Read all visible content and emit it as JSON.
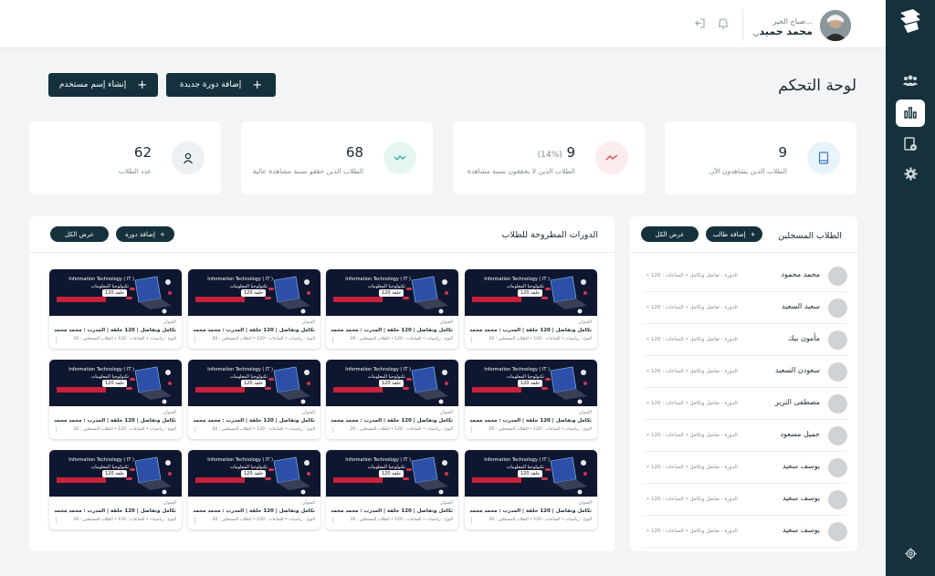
{
  "topbar": {
    "greeting": "صباح الخير...",
    "user_name": "محمد حميد"
  },
  "page": {
    "title": "لوحة التحكم",
    "add_course_label": "إضافة دورة جديدة",
    "create_user_label": "إنشاء إسم مستخدم"
  },
  "stats": [
    {
      "value": "9",
      "pct": "",
      "label": "الطلاب الذين يشاهدون الآن",
      "icon": "book-icon"
    },
    {
      "value": "9",
      "pct": "(14%)",
      "label": "الطلاب الذين لا يحققون نسبة مشاهدة",
      "icon": "trend-down-icon"
    },
    {
      "value": "68",
      "pct": "",
      "label": "الطلاب الذين حققو نسبة مشاهدة عالية",
      "icon": "trend-up-icon"
    },
    {
      "value": "62",
      "pct": "",
      "label": "عدد الطلاب",
      "icon": "user-icon"
    }
  ],
  "courses_panel": {
    "title": "الدورات المطروحة للطلاب",
    "add_label": "إضافة دورة",
    "view_all_label": "عرض الكل"
  },
  "course_card": {
    "thumb_title": "Information Technology ( IT )",
    "thumb_subtitle": "تكنولوجيا المعلومات",
    "thumb_banner": "تكنولوجيا المعلومات مجانا",
    "badge": "120 حلقة",
    "label": "العنوان",
    "line1": "تكامل وتفاضل | 120 حلقة | المدرب : محمد محمد",
    "line2": "النوع : رياضيات  •  الساعات : 120  •  الطلاب المسجلين : 20"
  },
  "students_panel": {
    "title": "الطلاب المسجلين",
    "add_label": "إضافة طالب",
    "view_all_label": "عرض الكل",
    "meta": "• الدورة : تفاضل وتكامل  •  الساعات : 120",
    "students": [
      "محمد محمود",
      "سعيد السعيد",
      "مأمون بيك",
      "سعودن السعيد",
      "مصطفى الترير",
      "جميل مسعود",
      "يوسف سعيد",
      "يوسف سعيد",
      "يوسف سعيد"
    ]
  },
  "colors": {
    "sidebar": "#14313c",
    "accent_dark": "#14313c",
    "trend_down": "#e0425a",
    "trend_up": "#2bb39c",
    "book_blue": "#3b7bc1"
  }
}
